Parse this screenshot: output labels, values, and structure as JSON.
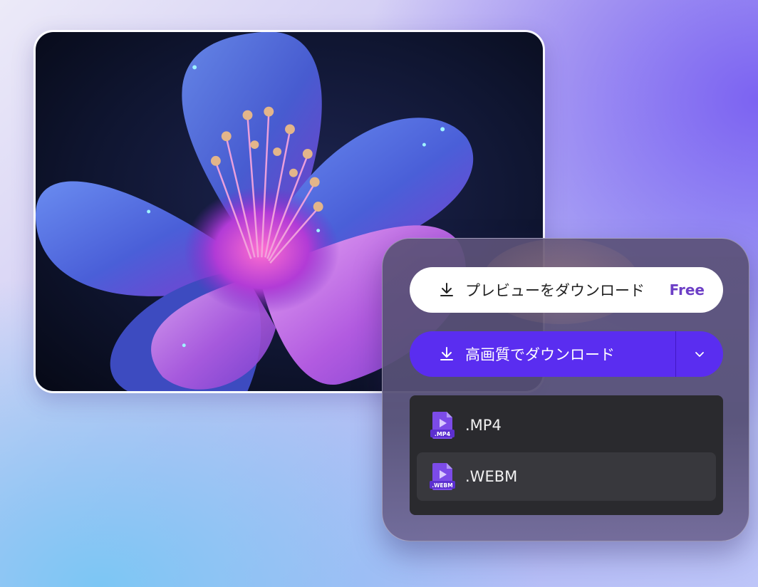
{
  "image_card": {
    "subject": "flower-photo"
  },
  "download_panel": {
    "preview_button": {
      "label": "プレビューをダウンロード",
      "badge": "Free",
      "icon": "download-icon"
    },
    "hq_button": {
      "label": "高画質でダウンロード",
      "icon": "download-icon",
      "dropdown_icon": "chevron-down-icon"
    },
    "formats": [
      {
        "name": ".MP4",
        "icon_text": ".MP4",
        "icon": "video-file-icon"
      },
      {
        "name": ".WEBM",
        "icon_text": ".WEBM",
        "icon": "video-file-icon"
      }
    ],
    "colors": {
      "accent": "#5a2df0",
      "badge": "#6d3fc6",
      "list_bg": "#2a2a2e"
    }
  }
}
